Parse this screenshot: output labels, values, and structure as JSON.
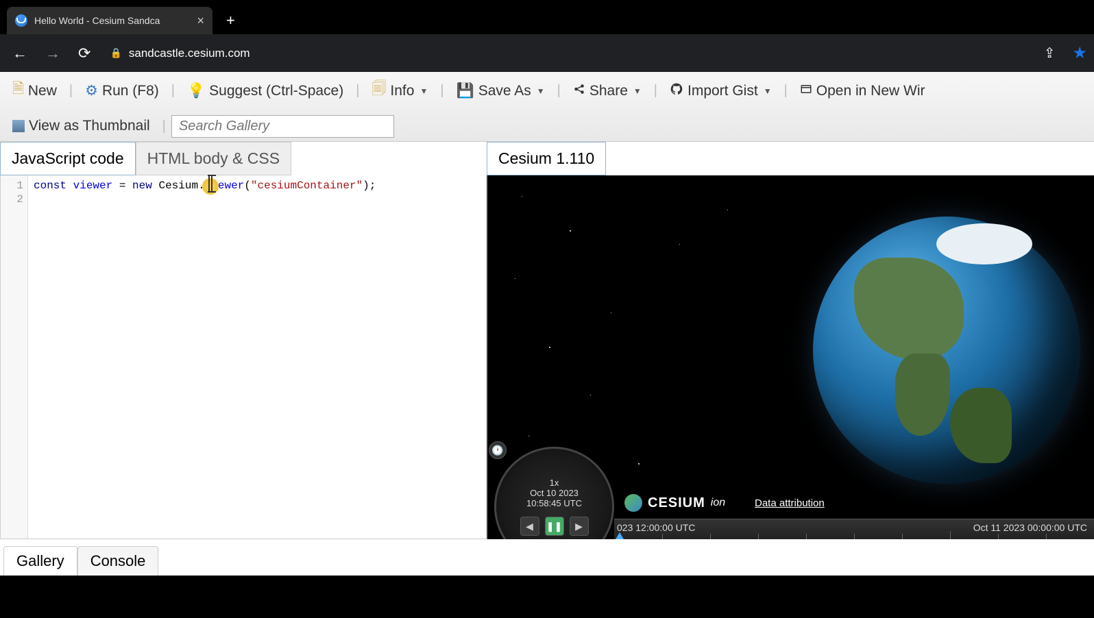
{
  "browser": {
    "tab_title": "Hello World - Cesium Sandca",
    "url": "sandcastle.cesium.com"
  },
  "toolbar": {
    "new": "New",
    "run": "Run (F8)",
    "suggest": "Suggest (Ctrl-Space)",
    "info": "Info",
    "saveas": "Save As",
    "share": "Share",
    "import": "Import Gist",
    "opennew": "Open in New Wir",
    "thumbnail": "View as Thumbnail",
    "search_placeholder": "Search Gallery"
  },
  "code_tabs": {
    "js": "JavaScript code",
    "html": "HTML body & CSS"
  },
  "code": {
    "line1_const": "const",
    "line1_viewer": " viewer",
    "line1_eq": " = ",
    "line1_new": "new",
    "line1_cesium": " Cesium.",
    "line1_class": "Viewer",
    "line1_open": "(",
    "line1_str": "\"cesiumContainer\"",
    "line1_close": ");"
  },
  "viewer": {
    "version": "Cesium 1.110",
    "clock_speed": "1x",
    "clock_date": "Oct 10 2023",
    "clock_time": "10:58:45 UTC",
    "timeline_left": "023 12:00:00 UTC",
    "timeline_right": "Oct 11 2023 00:00:00 UTC",
    "logo": "CESIUM",
    "logo_sub": "ion",
    "attribution": "Data attribution"
  },
  "bottom": {
    "gallery": "Gallery",
    "console": "Console"
  }
}
